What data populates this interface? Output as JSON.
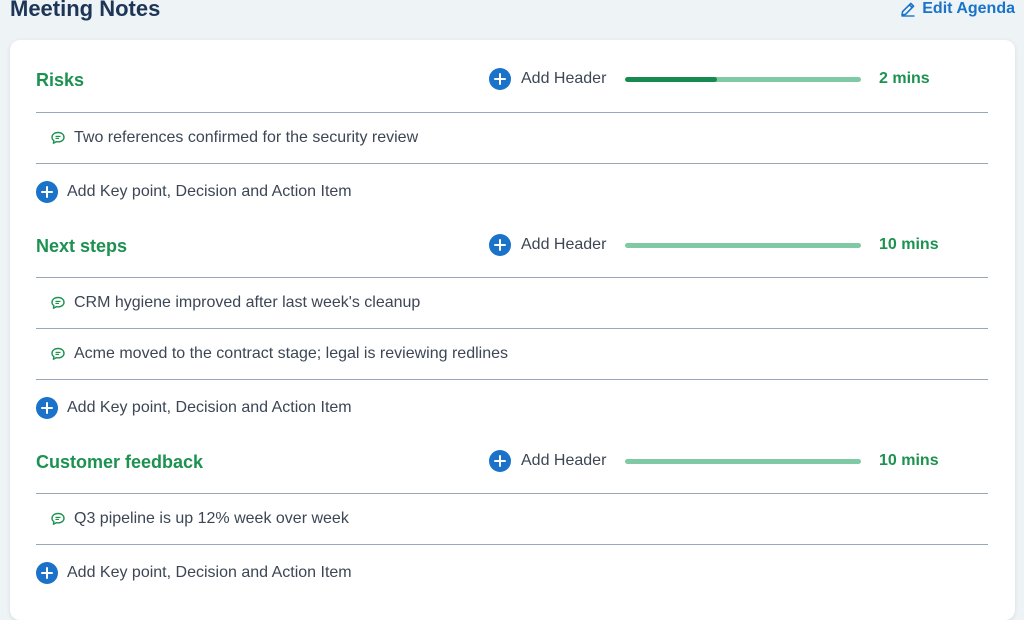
{
  "page": {
    "title": "Meeting Notes",
    "edit_agenda_label": "Edit Agenda"
  },
  "sections": [
    {
      "title": "Risks",
      "add_header_label": "Add Header",
      "duration": "2 mins",
      "progress": 0.39,
      "notes": [
        "Two references confirmed for the security review"
      ],
      "add_item_label": "Add Key point, Decision and Action Item"
    },
    {
      "title": "Next steps",
      "add_header_label": "Add Header",
      "duration": "10 mins",
      "progress": 0,
      "notes": [
        "CRM hygiene improved after last week's cleanup",
        "Acme moved to the contract stage; legal is reviewing redlines"
      ],
      "add_item_label": "Add Key point, Decision and Action Item"
    },
    {
      "title": "Customer feedback",
      "add_header_label": "Add Header",
      "duration": "10 mins",
      "progress": 0,
      "notes": [
        "Q3 pipeline is up 12% week over week"
      ],
      "add_item_label": "Add Key point, Decision and Action Item"
    }
  ],
  "colors": {
    "accent_blue": "#1a73c8",
    "section_green": "#1c9150",
    "progress_track": "#7fc9a4",
    "progress_fill": "#168a50"
  }
}
